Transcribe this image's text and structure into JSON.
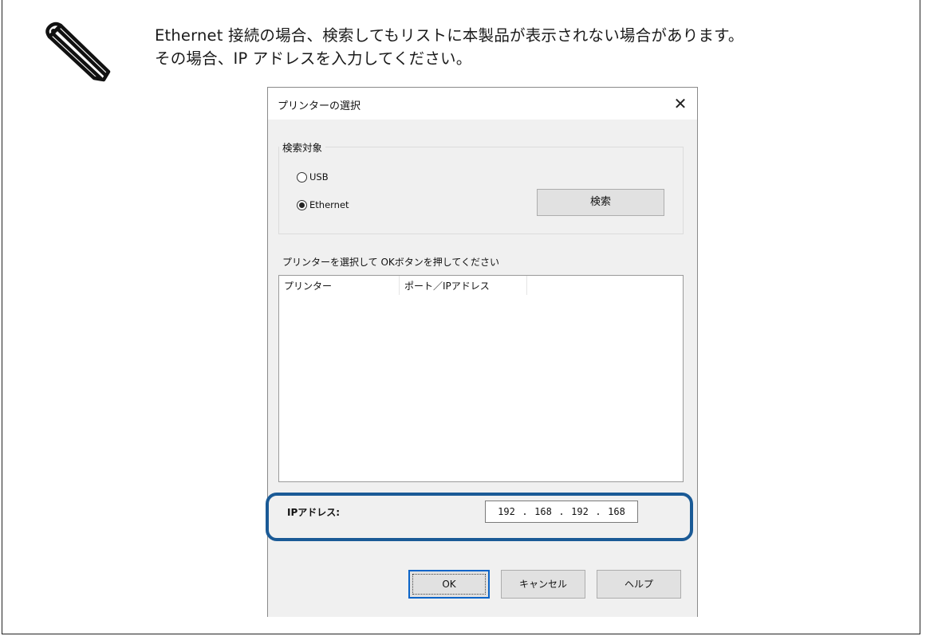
{
  "note": {
    "icon": "pencil-note-icon",
    "line1": "Ethernet 接続の場合、検索してもリストに本製品が表示されない場合があります。",
    "line2": "その場合、IP アドレスを入力してください。"
  },
  "dialog": {
    "title": "プリンターの選択",
    "close_icon": "close-icon",
    "search_target": {
      "label": "検索対象",
      "options": [
        {
          "label": "USB",
          "checked": false
        },
        {
          "label": "Ethernet",
          "checked": true
        }
      ],
      "search_button": "検索"
    },
    "list": {
      "label": "プリンターを選択して OKボタンを押してください",
      "columns": [
        "プリンター",
        "ポート／IPアドレス"
      ]
    },
    "ip": {
      "label": "IPアドレス:",
      "octets": [
        "192",
        "168",
        "192",
        "168"
      ],
      "dot": "."
    },
    "buttons": {
      "ok": "OK",
      "cancel": "キャンセル",
      "help": "ヘルプ"
    },
    "highlight_color": "#1a5a96"
  }
}
